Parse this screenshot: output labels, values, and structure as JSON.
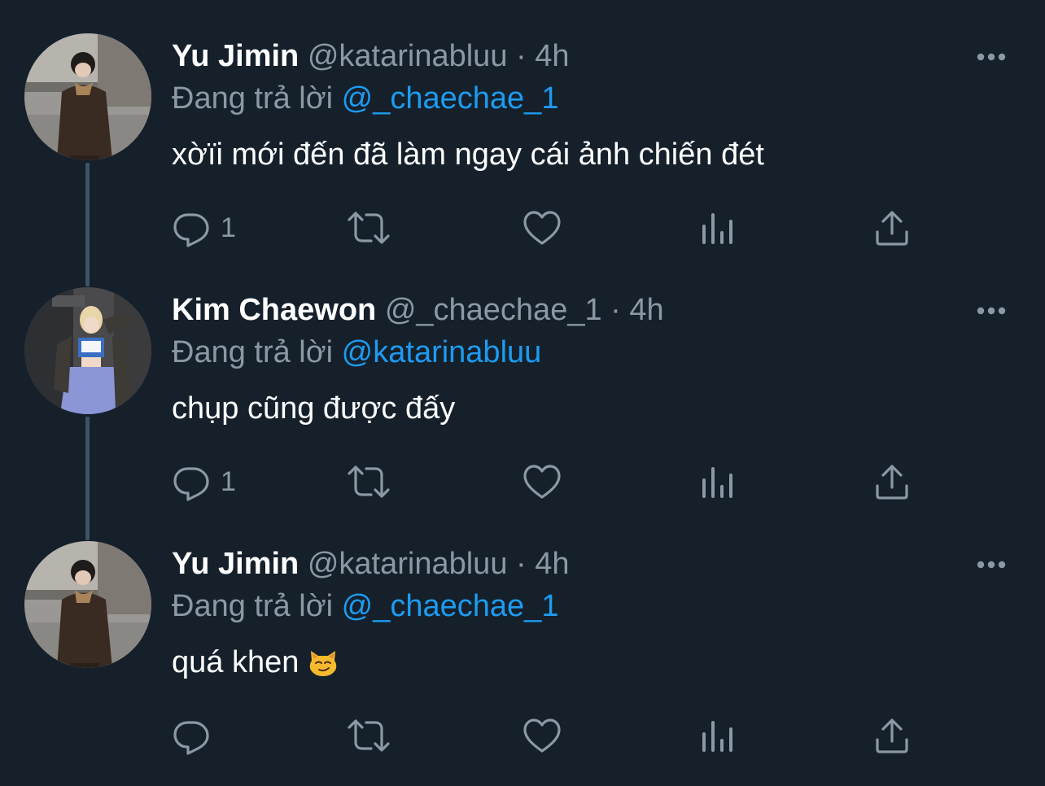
{
  "tweets": [
    {
      "name": "Yu Jimin",
      "handle": "@katarinabluu",
      "separator": "·",
      "time": "4h",
      "reply_prefix": "Đang trả lời",
      "reply_handle": "@_chaechae_1",
      "text": "xờïi mới đến đã làm ngay cái ảnh chiến đét",
      "reply_count": "1",
      "avatar_icon": "profile-photo-avatar",
      "emoji": ""
    },
    {
      "name": "Kim Chaewon",
      "handle": "@_chaechae_1",
      "separator": "·",
      "time": "4h",
      "reply_prefix": "Đang trả lời",
      "reply_handle": "@katarinabluu",
      "text": "chụp cũng được đấy",
      "reply_count": "1",
      "avatar_icon": "profile-photo-avatar",
      "emoji": ""
    },
    {
      "name": "Yu Jimin",
      "handle": "@katarinabluu",
      "separator": "·",
      "time": "4h",
      "reply_prefix": "Đang trả lời",
      "reply_handle": "@_chaechae_1",
      "text": "quá khen",
      "reply_count": "",
      "avatar_icon": "profile-photo-avatar",
      "emoji": "smirking-cat-emoji"
    }
  ],
  "icons": {
    "more": "more-dots-icon",
    "reply": "reply-bubble-icon",
    "retweet": "retweet-icon",
    "like": "heart-icon",
    "stats": "analytics-bars-icon",
    "share": "share-upload-icon"
  },
  "colors": {
    "background": "#15202b",
    "primary_text": "#ffffff",
    "secondary_text": "#8b98a5",
    "link": "#1d9bf0",
    "thread_line": "#3d5466"
  }
}
